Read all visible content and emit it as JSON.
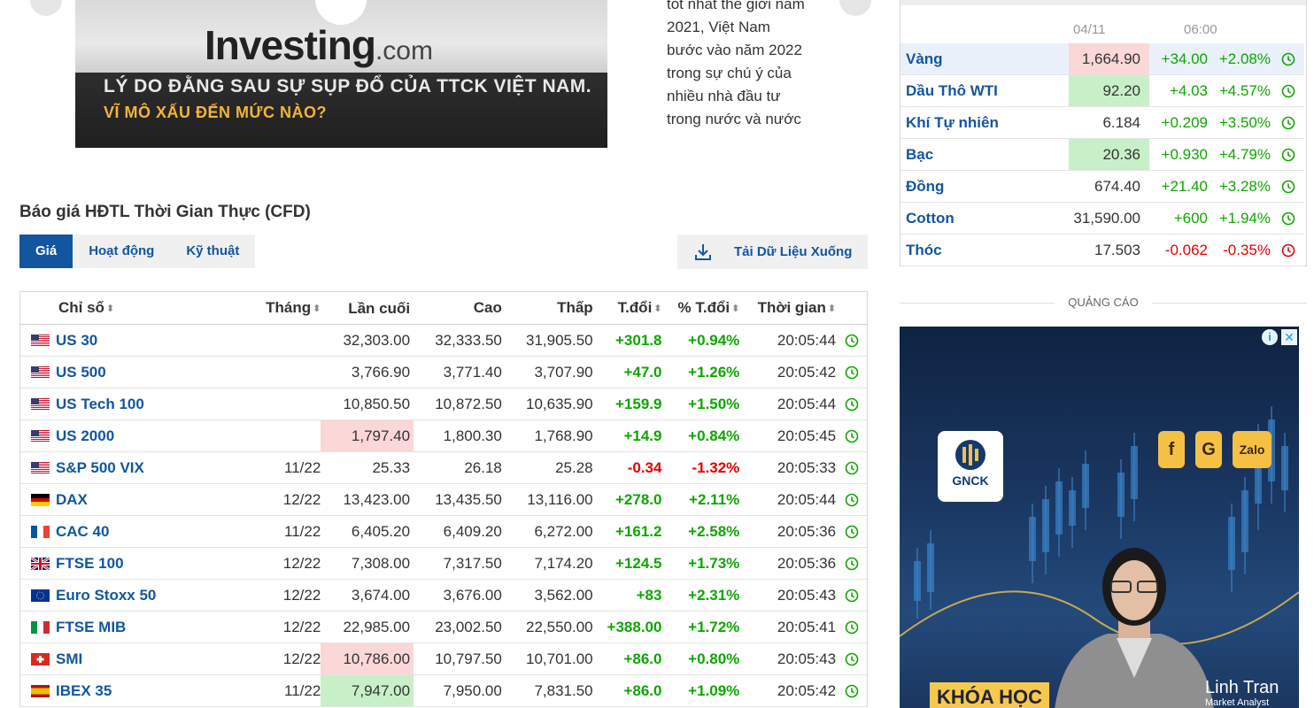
{
  "video": {
    "logo_main": "Investing",
    "logo_suffix": ".com",
    "headline_line1": "LÝ DO ĐẰNG SAU SỰ SỤP ĐỔ CỦA TTCK VIỆT NAM.",
    "headline_line2": "VĨ MÔ XẤU ĐẾN MỨC NÀO?"
  },
  "article": {
    "snippet": "tốt nhất thế giới năm 2021, Việt Nam bước vào năm 2022 trong sự chú ý của nhiều nhà đầu tư trong nước và nước"
  },
  "section": {
    "title": "Báo giá HĐTL Thời Gian Thực (CFD)"
  },
  "tabs": [
    {
      "label": "Giá",
      "active": true
    },
    {
      "label": "Hoạt động",
      "active": false
    },
    {
      "label": "Kỹ thuật",
      "active": false
    }
  ],
  "download": {
    "label": "Tải Dữ Liệu Xuống",
    "icon": "download-icon"
  },
  "table": {
    "headers": {
      "name": "Chỉ số",
      "month": "Tháng",
      "last": "Lần cuối",
      "high": "Cao",
      "low": "Thấp",
      "chg": "T.đổi",
      "pct": "% T.đổi",
      "time": "Thời gian"
    },
    "rows": [
      {
        "flag": "us",
        "name": "US 30",
        "month": "",
        "last": "32,303.00",
        "high": "32,333.50",
        "low": "31,905.50",
        "chg": "+301.8",
        "pct": "+0.94%",
        "time": "20:05:44",
        "dir": "pos",
        "hl": ""
      },
      {
        "flag": "us",
        "name": "US 500",
        "month": "",
        "last": "3,766.90",
        "high": "3,771.40",
        "low": "3,707.90",
        "chg": "+47.0",
        "pct": "+1.26%",
        "time": "20:05:42",
        "dir": "pos",
        "hl": ""
      },
      {
        "flag": "us",
        "name": "US Tech 100",
        "month": "",
        "last": "10,850.50",
        "high": "10,872.50",
        "low": "10,635.90",
        "chg": "+159.9",
        "pct": "+1.50%",
        "time": "20:05:44",
        "dir": "pos",
        "hl": ""
      },
      {
        "flag": "us",
        "name": "US 2000",
        "month": "",
        "last": "1,797.40",
        "high": "1,800.30",
        "low": "1,768.90",
        "chg": "+14.9",
        "pct": "+0.84%",
        "time": "20:05:45",
        "dir": "pos",
        "hl": "red"
      },
      {
        "flag": "us",
        "name": "S&P 500 VIX",
        "month": "11/22",
        "last": "25.33",
        "high": "26.18",
        "low": "25.28",
        "chg": "-0.34",
        "pct": "-1.32%",
        "time": "20:05:33",
        "dir": "neg",
        "hl": ""
      },
      {
        "flag": "de",
        "name": "DAX",
        "month": "12/22",
        "last": "13,423.00",
        "high": "13,435.50",
        "low": "13,116.00",
        "chg": "+278.0",
        "pct": "+2.11%",
        "time": "20:05:44",
        "dir": "pos",
        "hl": ""
      },
      {
        "flag": "fr",
        "name": "CAC 40",
        "month": "11/22",
        "last": "6,405.20",
        "high": "6,409.20",
        "low": "6,272.00",
        "chg": "+161.2",
        "pct": "+2.58%",
        "time": "20:05:36",
        "dir": "pos",
        "hl": ""
      },
      {
        "flag": "gb",
        "name": "FTSE 100",
        "month": "12/22",
        "last": "7,308.00",
        "high": "7,317.50",
        "low": "7,174.20",
        "chg": "+124.5",
        "pct": "+1.73%",
        "time": "20:05:36",
        "dir": "pos",
        "hl": ""
      },
      {
        "flag": "eu",
        "name": "Euro Stoxx 50",
        "month": "12/22",
        "last": "3,674.00",
        "high": "3,676.00",
        "low": "3,562.00",
        "chg": "+83",
        "pct": "+2.31%",
        "time": "20:05:43",
        "dir": "pos",
        "hl": ""
      },
      {
        "flag": "it",
        "name": "FTSE MIB",
        "month": "12/22",
        "last": "22,985.00",
        "high": "23,002.50",
        "low": "22,550.00",
        "chg": "+388.00",
        "pct": "+1.72%",
        "time": "20:05:41",
        "dir": "pos",
        "hl": ""
      },
      {
        "flag": "ch",
        "name": "SMI",
        "month": "12/22",
        "last": "10,786.00",
        "high": "10,797.50",
        "low": "10,701.00",
        "chg": "+86.0",
        "pct": "+0.80%",
        "time": "20:05:43",
        "dir": "pos",
        "hl": "red"
      },
      {
        "flag": "es",
        "name": "IBEX 35",
        "month": "11/22",
        "last": "7,947.00",
        "high": "7,950.00",
        "low": "7,831.50",
        "chg": "+86.0",
        "pct": "+1.09%",
        "time": "20:05:42",
        "dir": "pos",
        "hl": "green"
      }
    ]
  },
  "commodities": {
    "header_date": "04/11",
    "header_time": "06:00",
    "rows": [
      {
        "name": "Vàng",
        "last": "1,664.90",
        "chg": "+34.00",
        "pct": "+2.08%",
        "dir": "pos",
        "hl": "red"
      },
      {
        "name": "Dầu Thô WTI",
        "last": "92.20",
        "chg": "+4.03",
        "pct": "+4.57%",
        "dir": "pos",
        "hl": "green"
      },
      {
        "name": "Khí Tự nhiên",
        "last": "6.184",
        "chg": "+0.209",
        "pct": "+3.50%",
        "dir": "pos",
        "hl": ""
      },
      {
        "name": "Bạc",
        "last": "20.36",
        "chg": "+0.930",
        "pct": "+4.79%",
        "dir": "pos",
        "hl": "green"
      },
      {
        "name": "Đồng",
        "last": "674.40",
        "chg": "+21.40",
        "pct": "+3.28%",
        "dir": "pos",
        "hl": ""
      },
      {
        "name": "Cotton",
        "last": "31,590.00",
        "chg": "+600",
        "pct": "+1.94%",
        "dir": "pos",
        "hl": ""
      },
      {
        "name": "Thóc",
        "last": "17.503",
        "chg": "-0.062",
        "pct": "-0.35%",
        "dir": "neg",
        "hl": ""
      }
    ]
  },
  "ad": {
    "label": "QUẢNG CÁO",
    "logo_text": "GNCK",
    "social": [
      "f",
      "G",
      "Zalo"
    ],
    "title": "KHÓA HỌC",
    "person_name": "Linh Tran",
    "person_role": "Market Analyst",
    "info_icon": "info-icon",
    "close_icon": "close-icon"
  },
  "colors": {
    "link_blue": "#1256a0",
    "positive": "#0ea600",
    "negative": "#e50000",
    "highlight_red": "#fbd7d7",
    "highlight_green": "#c8f0c8"
  }
}
